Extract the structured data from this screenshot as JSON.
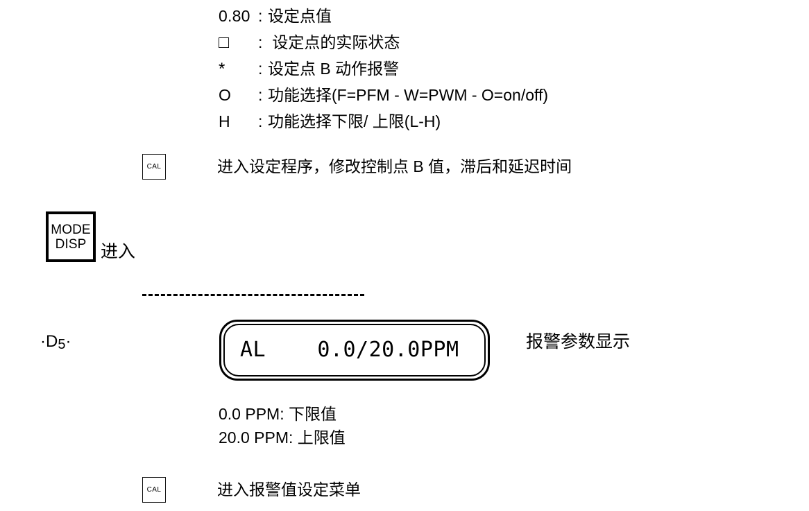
{
  "legend": {
    "rows": [
      {
        "symbol": "0.80",
        "colon": ":",
        "text": "设定点值"
      },
      {
        "symbol": "□",
        "colon": ":",
        "text": " 设定点的实际状态"
      },
      {
        "symbol": "*",
        "colon": ":",
        "text": "设定点 B 动作报警"
      },
      {
        "symbol": "O",
        "colon": ":",
        "text": "功能选择(F=PFM - W=PWM - O=on/off)"
      },
      {
        "symbol": "H",
        "colon": ":",
        "text": "功能选择下限/ 上限(L-H)"
      }
    ]
  },
  "cal_step_1": {
    "key_label": "CAL",
    "description": "进入设定程序，修改控制点 B 值，滞后和延迟时间"
  },
  "mode_step": {
    "key_line_1": "MODE",
    "key_line_2": "DISP",
    "description": "进入"
  },
  "display_step": {
    "step_label_prefix": "·D",
    "step_label_number": "5",
    "step_label_suffix": "·",
    "lcd_text": "AL    0.0/20.0PPM",
    "caption": "报警参数显示"
  },
  "limits": {
    "lower": "0.0 PPM: 下限值",
    "upper": "20.0 PPM: 上限值"
  },
  "cal_step_2": {
    "key_label": "CAL",
    "description": "进入报警值设定菜单"
  }
}
